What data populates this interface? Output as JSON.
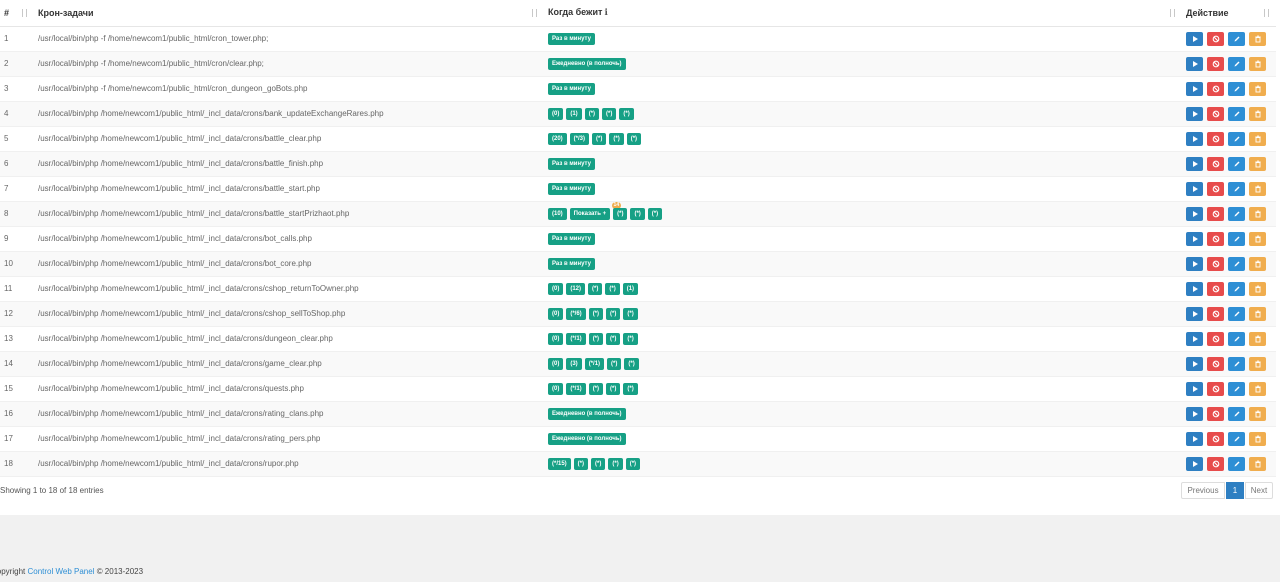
{
  "table": {
    "headers": {
      "num": "#",
      "task": "Крон-задачи",
      "when": "Когда бежит",
      "when_info": "ℹ",
      "action": "Действие"
    },
    "rows": [
      {
        "num": "1",
        "cmd": "/usr/local/bin/php -f /home/newcom1/public_html/cron_tower.php;",
        "badges": [
          {
            "t": "Раз в минуту"
          }
        ]
      },
      {
        "num": "2",
        "cmd": "/usr/local/bin/php -f /home/newcom1/public_html/cron/clear.php;",
        "badges": [
          {
            "t": "Ежедневно (в полночь)"
          }
        ]
      },
      {
        "num": "3",
        "cmd": "/usr/local/bin/php -f /home/newcom1/public_html/cron_dungeon_goBots.php",
        "badges": [
          {
            "t": "Раз в минуту"
          }
        ]
      },
      {
        "num": "4",
        "cmd": "/usr/local/bin/php /home/newcom1/public_html/_incl_data/crons/bank_updateExchangeRares.php",
        "badges": [
          {
            "t": "(0)"
          },
          {
            "t": "(1)"
          },
          {
            "t": "(*)"
          },
          {
            "t": "(*)"
          },
          {
            "t": "(*)"
          }
        ]
      },
      {
        "num": "5",
        "cmd": "/usr/local/bin/php /home/newcom1/public_html/_incl_data/crons/battle_clear.php",
        "badges": [
          {
            "t": "(20)"
          },
          {
            "t": "(*/3)"
          },
          {
            "t": "(*)"
          },
          {
            "t": "(*)"
          },
          {
            "t": "(*)"
          }
        ]
      },
      {
        "num": "6",
        "cmd": "/usr/local/bin/php /home/newcom1/public_html/_incl_data/crons/battle_finish.php",
        "badges": [
          {
            "t": "Раз в минуту"
          }
        ]
      },
      {
        "num": "7",
        "cmd": "/usr/local/bin/php /home/newcom1/public_html/_incl_data/crons/battle_start.php",
        "badges": [
          {
            "t": "Раз в минуту"
          }
        ]
      },
      {
        "num": "8",
        "cmd": "/usr/local/bin/php /home/newcom1/public_html/_incl_data/crons/battle_startPrizhaot.php",
        "badges": [
          {
            "t": "(10)"
          },
          {
            "t": "Показать +",
            "c": "14"
          },
          {
            "t": "(*)"
          },
          {
            "t": "(*)"
          },
          {
            "t": "(*)"
          }
        ]
      },
      {
        "num": "9",
        "cmd": "/usr/local/bin/php /home/newcom1/public_html/_incl_data/crons/bot_calls.php",
        "badges": [
          {
            "t": "Раз в минуту"
          }
        ]
      },
      {
        "num": "10",
        "cmd": "/usr/local/bin/php /home/newcom1/public_html/_incl_data/crons/bot_core.php",
        "badges": [
          {
            "t": "Раз в минуту"
          }
        ]
      },
      {
        "num": "11",
        "cmd": "/usr/local/bin/php /home/newcom1/public_html/_incl_data/crons/cshop_returnToOwner.php",
        "badges": [
          {
            "t": "(0)"
          },
          {
            "t": "(12)"
          },
          {
            "t": "(*)"
          },
          {
            "t": "(*)"
          },
          {
            "t": "(1)"
          }
        ]
      },
      {
        "num": "12",
        "cmd": "/usr/local/bin/php /home/newcom1/public_html/_incl_data/crons/cshop_sellToShop.php",
        "badges": [
          {
            "t": "(0)"
          },
          {
            "t": "(*/6)"
          },
          {
            "t": "(*)"
          },
          {
            "t": "(*)"
          },
          {
            "t": "(*)"
          }
        ]
      },
      {
        "num": "13",
        "cmd": "/usr/local/bin/php /home/newcom1/public_html/_incl_data/crons/dungeon_clear.php",
        "badges": [
          {
            "t": "(0)"
          },
          {
            "t": "(*/1)"
          },
          {
            "t": "(*)"
          },
          {
            "t": "(*)"
          },
          {
            "t": "(*)"
          }
        ]
      },
      {
        "num": "14",
        "cmd": "/usr/local/bin/php /home/newcom1/public_html/_incl_data/crons/game_clear.php",
        "badges": [
          {
            "t": "(0)"
          },
          {
            "t": "(3)"
          },
          {
            "t": "(*/1)"
          },
          {
            "t": "(*)"
          },
          {
            "t": "(*)"
          }
        ]
      },
      {
        "num": "15",
        "cmd": "/usr/local/bin/php /home/newcom1/public_html/_incl_data/crons/quests.php",
        "badges": [
          {
            "t": "(0)"
          },
          {
            "t": "(*/1)"
          },
          {
            "t": "(*)"
          },
          {
            "t": "(*)"
          },
          {
            "t": "(*)"
          }
        ]
      },
      {
        "num": "16",
        "cmd": "/usr/local/bin/php /home/newcom1/public_html/_incl_data/crons/rating_clans.php",
        "badges": [
          {
            "t": "Ежедневно (в полночь)"
          }
        ]
      },
      {
        "num": "17",
        "cmd": "/usr/local/bin/php /home/newcom1/public_html/_incl_data/crons/rating_pers.php",
        "badges": [
          {
            "t": "Ежедневно (в полночь)"
          }
        ]
      },
      {
        "num": "18",
        "cmd": "/usr/local/bin/php /home/newcom1/public_html/_incl_data/crons/rupor.php",
        "badges": [
          {
            "t": "(*/15)"
          },
          {
            "t": "(*)"
          },
          {
            "t": "(*)"
          },
          {
            "t": "(*)"
          },
          {
            "t": "(*)"
          }
        ]
      }
    ]
  },
  "info": "Showing 1 to 18 of 18 entries",
  "pagination": {
    "prev": "Previous",
    "current": "1",
    "next": "Next"
  },
  "footer": {
    "pre": "Copyright ",
    "brand": "Control Web Panel",
    "post": " © 2013-2023"
  },
  "colors": {
    "badge": "#16a085",
    "run": "#2e7fc2",
    "stop": "#e74c4c",
    "edit": "#2e8fd5",
    "delete": "#f0ad4e"
  },
  "action_icons": [
    "play-icon",
    "ban-icon",
    "pencil-icon",
    "trash-icon"
  ]
}
